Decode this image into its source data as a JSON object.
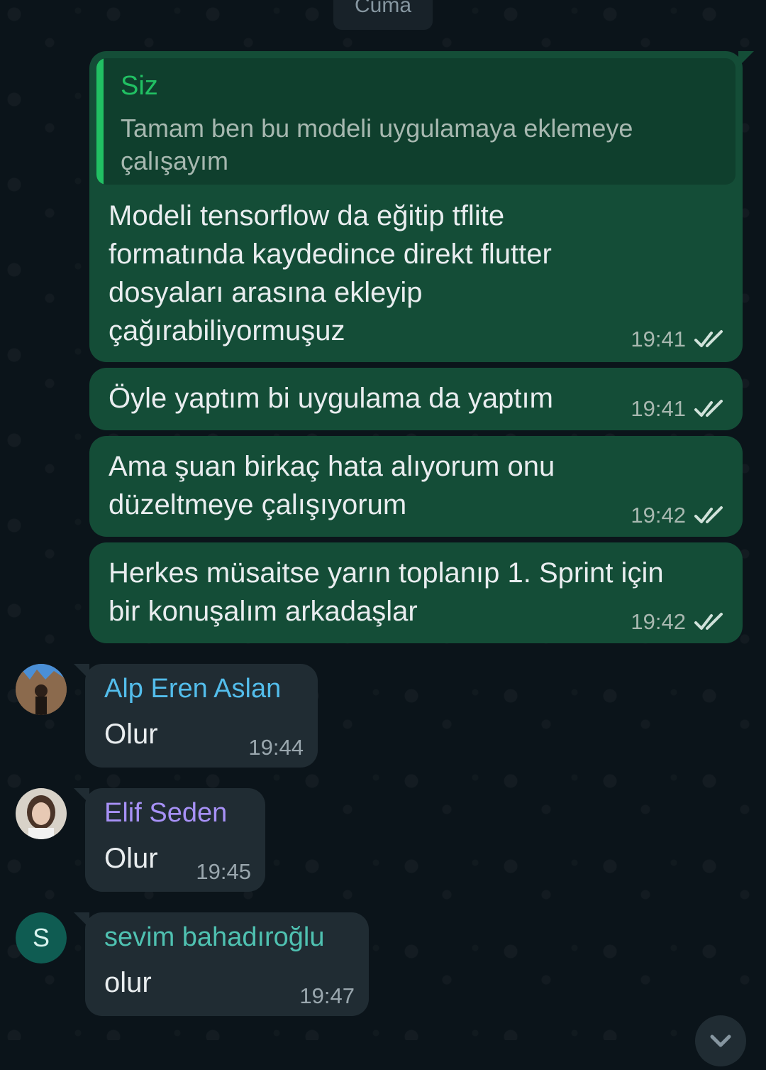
{
  "date_chip": "Cuma",
  "messages": [
    {
      "quote": {
        "author": "Siz",
        "text": "Tamam ben bu modeli uygulamaya eklemeye çalışayım"
      },
      "text": "Modeli tensorflow da eğitip tflite formatında kaydedince direkt flutter dosyaları arasına ekleyip çağırabiliyormuşuz",
      "time": "19:41"
    },
    {
      "text": "Öyle yaptım bi uygulama da yaptım",
      "time": "19:41"
    },
    {
      "text": "Ama şuan birkaç hata alıyorum onu düzeltmeye çalışıyorum",
      "time": "19:42"
    },
    {
      "text": "Herkes müsaitse yarın toplanıp 1. Sprint için bir konuşalım arkadaşlar",
      "time": "19:42"
    }
  ],
  "incoming": [
    {
      "sender": "Alp Eren Aslan",
      "sender_color": "#53bdeb",
      "text": "Olur",
      "time": "19:44"
    },
    {
      "sender": "Elif Seden",
      "sender_color": "#a791f6",
      "text": "Olur",
      "time": "19:45"
    },
    {
      "sender": "sevim bahadıroğlu",
      "sender_color": "#4fc1b1",
      "avatar_letter": "S",
      "text": "olur",
      "time": "19:47"
    }
  ],
  "colors": {
    "background": "#0b141a",
    "outgoing_bubble": "#144d37",
    "incoming_bubble": "#202c33",
    "accent": "#21c063",
    "read_ticks": "#d0e2da"
  },
  "icons": {
    "read_receipt": "double-check-icon",
    "scroll_down": "chevron-down-icon"
  }
}
